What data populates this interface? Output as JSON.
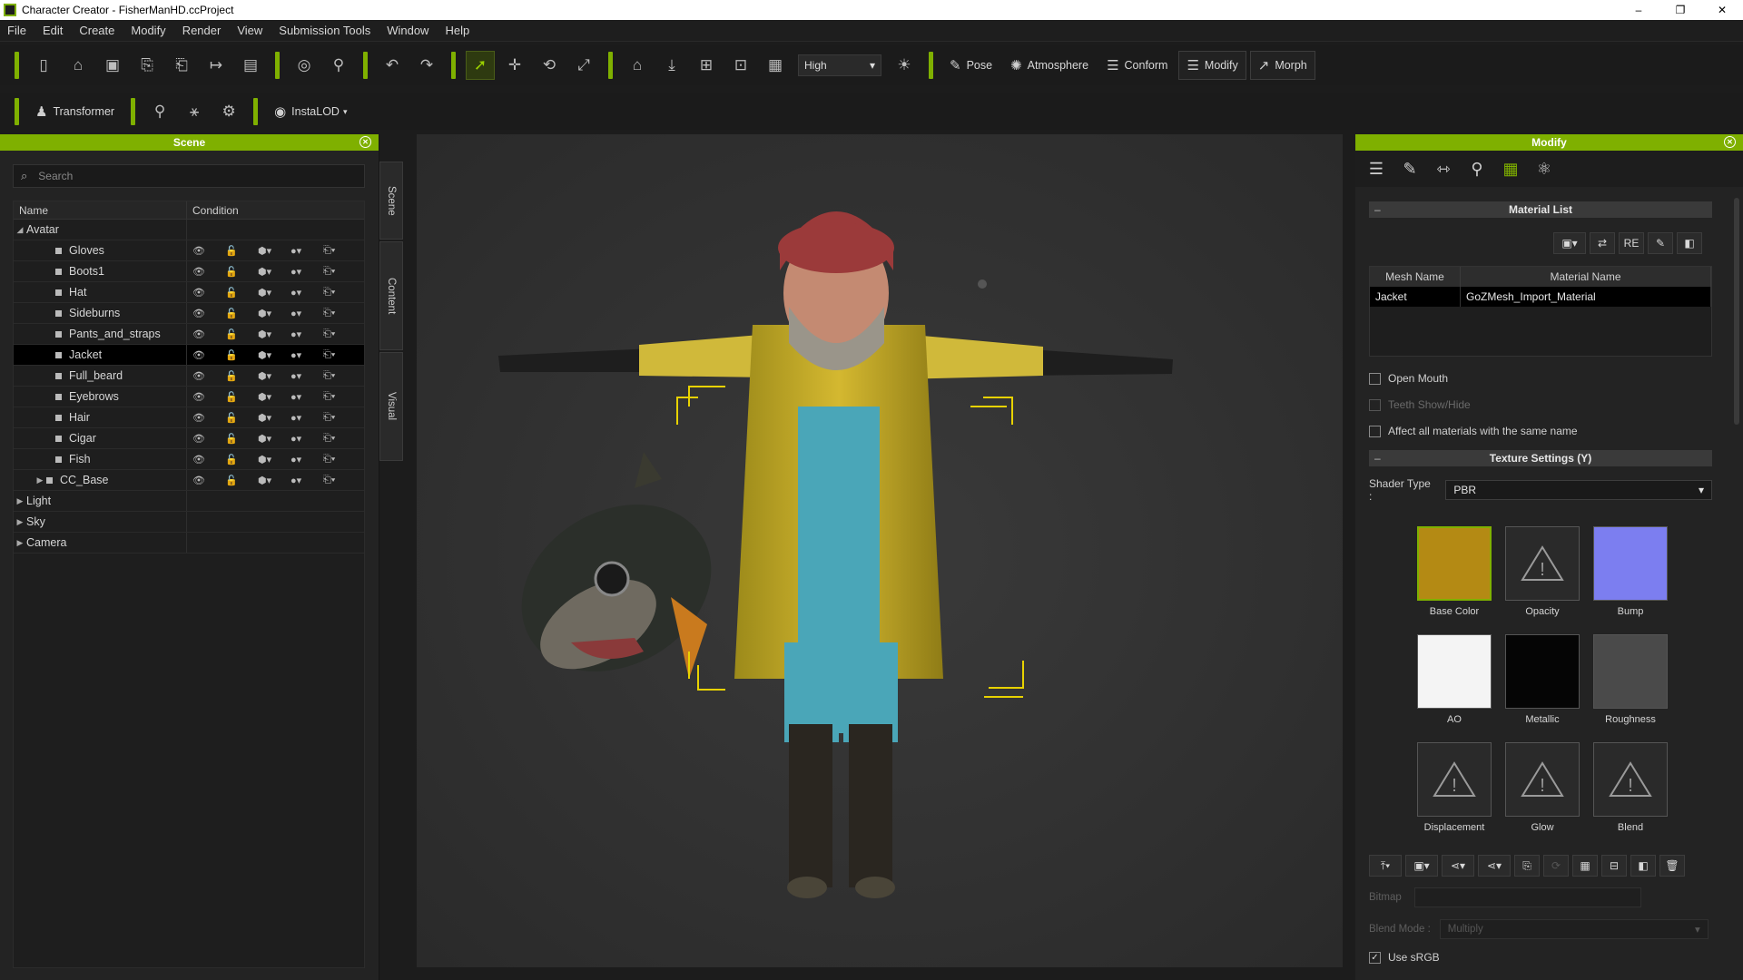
{
  "window": {
    "title": "Character Creator - FisherManHD.ccProject",
    "controls": [
      "–",
      "❐",
      "✕"
    ]
  },
  "menu": [
    "File",
    "Edit",
    "Create",
    "Modify",
    "Render",
    "View",
    "Submission Tools",
    "Window",
    "Help"
  ],
  "toolbar": {
    "quality": "High",
    "pose_label": "Pose",
    "atmosphere_label": "Atmosphere",
    "conform_label": "Conform",
    "modify_label": "Modify",
    "morph_label": "Morph",
    "transformer_label": "Transformer",
    "instalod_label": "InstaLOD"
  },
  "scene_panel": {
    "title": "Scene",
    "search_placeholder": "Search",
    "col_name": "Name",
    "col_condition": "Condition",
    "avatar_label": "Avatar",
    "items": [
      "Gloves",
      "Boots1",
      "Hat",
      "Sideburns",
      "Pants_and_straps",
      "Jacket",
      "Full_beard",
      "Eyebrows",
      "Hair",
      "Cigar",
      "Fish",
      "CC_Base"
    ],
    "selected": "Jacket",
    "roots": [
      "Light",
      "Sky",
      "Camera"
    ]
  },
  "vtabs": [
    "Scene",
    "Content",
    "Visual"
  ],
  "modify_panel": {
    "title": "Modify",
    "material_list_title": "Material List",
    "col_mesh": "Mesh Name",
    "col_material": "Material Name",
    "mesh_name": "Jacket",
    "material_name": "GoZMesh_Import_Material",
    "re_label": "RE",
    "open_mouth": "Open Mouth",
    "teeth_show_hide": "Teeth Show/Hide",
    "affect_all": "Affect all materials with the same name",
    "texture_settings_title": "Texture Settings  (Y)",
    "shader_type_label": "Shader Type :",
    "shader_type": "PBR",
    "textures": [
      "Base Color",
      "Opacity",
      "Bump",
      "AO",
      "Metallic",
      "Roughness",
      "Displacement",
      "Glow",
      "Blend"
    ],
    "bitmap_label": "Bitmap",
    "blend_mode_label": "Blend Mode :",
    "blend_mode": "Multiply",
    "use_srgb": "Use sRGB"
  },
  "colors": {
    "accent": "#7fb000",
    "panel": "#232323",
    "viewport": "#313131"
  }
}
